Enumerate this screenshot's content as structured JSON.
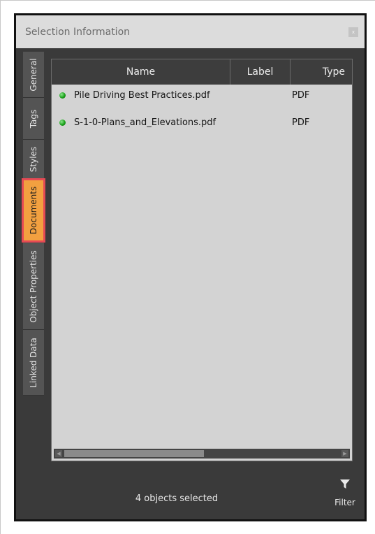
{
  "window": {
    "title": "Selection Information",
    "close_glyph": "x"
  },
  "side_tabs": [
    {
      "label": "General"
    },
    {
      "label": "Tags"
    },
    {
      "label": "Styles"
    },
    {
      "label": "Documents",
      "active": true
    },
    {
      "label": "Object Properties"
    },
    {
      "label": "Linked Data"
    }
  ],
  "table": {
    "columns": [
      "Name",
      "Label",
      "Type"
    ],
    "rows": [
      {
        "name": "Pile Driving Best Practices.pdf",
        "label": "",
        "type": "PDF",
        "status_color": "#1aa21a"
      },
      {
        "name": "S-1-0-Plans_and_Elevations.pdf",
        "label": "",
        "type": "PDF",
        "status_color": "#1aa21a"
      }
    ]
  },
  "footer": {
    "status_text": "4 objects selected",
    "filter_label": "Filter",
    "filter_icon": "funnel-icon"
  },
  "colors": {
    "panel_bg": "#3a3a3a",
    "active_tab": "#f2a040",
    "active_tab_outline": "#e64a54",
    "list_bg": "#d3d3d3"
  }
}
